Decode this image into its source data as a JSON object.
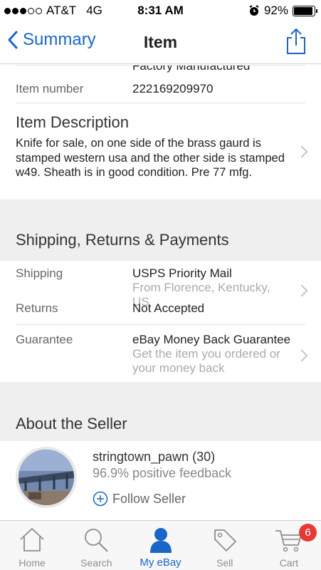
{
  "status_bar": {
    "carrier": "AT&T",
    "network": "4G",
    "time": "8:31 AM",
    "battery": "92%",
    "battery_level": 0.92,
    "signal_bars": 3
  },
  "nav": {
    "back_label": "Summary",
    "title": "Item",
    "share_icon": "share-icon"
  },
  "details": {
    "cut_off_text": "Factory Manufactured",
    "item_number_label": "Item number",
    "item_number_value": "222169209970"
  },
  "description": {
    "title": "Item Description",
    "body": "Knife for sale, on one side of the brass gaurd is stamped western usa and the other side is stamped w49. Sheath is in good condition. Pre 77 mfg."
  },
  "shipping_section": {
    "title": "Shipping, Returns & Payments",
    "shipping_label": "Shipping",
    "shipping_value": "USPS Priority Mail",
    "shipping_sub": "From Florence, Kentucky, US",
    "returns_label": "Returns",
    "returns_value": "Not Accepted",
    "guarantee_label": "Guarantee",
    "guarantee_value": "eBay Money Back Guarantee",
    "guarantee_sub": "Get the item you ordered or your money back"
  },
  "seller": {
    "section_title": "About the Seller",
    "name": "stringtown_pawn (30)",
    "feedback": "96.9% positive feedback",
    "follow_label": "Follow Seller"
  },
  "tab_bar": {
    "tabs": [
      {
        "label": "Home",
        "icon": "home-icon"
      },
      {
        "label": "Search",
        "icon": "search-icon"
      },
      {
        "label": "My eBay",
        "icon": "person-icon"
      },
      {
        "label": "Sell",
        "icon": "tag-icon"
      },
      {
        "label": "Cart",
        "icon": "cart-icon"
      }
    ],
    "active": "My eBay",
    "cart_badge": "6"
  },
  "colors": {
    "accent": "#1a66c8",
    "badge": "#e53935",
    "section_bg": "#efefef"
  }
}
